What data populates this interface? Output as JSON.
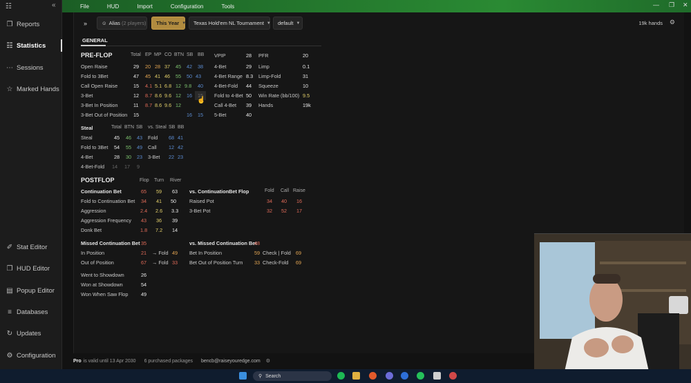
{
  "app": {
    "logo": "☷",
    "collapse": "«"
  },
  "menu": [
    "File",
    "HUD",
    "Import",
    "Configuration",
    "Tools"
  ],
  "sidebar": {
    "top": [
      {
        "icon": "❐",
        "label": "Reports"
      },
      {
        "icon": "☷",
        "label": "Statistics"
      },
      {
        "icon": "⋯",
        "label": "Sessions"
      },
      {
        "icon": "☆",
        "label": "Marked Hands"
      }
    ],
    "bottom": [
      {
        "icon": "✐",
        "label": "Stat Editor"
      },
      {
        "icon": "❐",
        "label": "HUD Editor"
      },
      {
        "icon": "▤",
        "label": "Popup Editor"
      },
      {
        "icon": "≡",
        "label": "Databases"
      },
      {
        "icon": "↻",
        "label": "Updates"
      },
      {
        "icon": "⚙",
        "label": "Configuration"
      }
    ]
  },
  "filters": {
    "expand": "»",
    "alias_label": "Alias",
    "alias_count": "(2 players)",
    "year": "This Year",
    "game": "Texas Hold'em NL Tournament",
    "preset": "default",
    "hands": "19k hands"
  },
  "tab": "GENERAL",
  "preflop": {
    "title": "PRE-FLOP",
    "cols": [
      "Total",
      "EP",
      "MP",
      "CO",
      "BTN",
      "SB",
      "BB"
    ],
    "rows": [
      {
        "label": "Open Raise",
        "vals": [
          "29",
          "20",
          "28",
          "37",
          "45",
          "42",
          "38"
        ]
      },
      {
        "label": "Fold to 3Bet",
        "vals": [
          "47",
          "45",
          "41",
          "46",
          "55",
          "50",
          "43"
        ]
      },
      {
        "label": "Call Open Raise",
        "vals": [
          "15",
          "4.1",
          "5.1",
          "6.8",
          "12",
          "9.8",
          "40"
        ]
      },
      {
        "label": "3-Bet",
        "vals": [
          "12",
          "8.7",
          "8.6",
          "9.6",
          "12",
          "16",
          "15"
        ]
      },
      {
        "label": "3-Bet In Position",
        "vals": [
          "11",
          "8.7",
          "8.6",
          "9.6",
          "12",
          "",
          ""
        ]
      },
      {
        "label": "3-Bet Out of Position",
        "vals": [
          "15",
          "",
          "",
          "",
          "",
          "16",
          "15"
        ]
      }
    ],
    "mid": [
      {
        "label": "VPIP",
        "val": "28"
      },
      {
        "label": "4-Bet",
        "val": "29"
      },
      {
        "label": "4-Bet Range",
        "val": "8.3"
      },
      {
        "label": "4-Bet-Fold",
        "val": "44"
      },
      {
        "label": "Fold to 4-Bet",
        "val": "50"
      },
      {
        "label": "Call 4-Bet",
        "val": "39"
      },
      {
        "label": "5-Bet",
        "val": "40"
      }
    ],
    "right": [
      {
        "label": "PFR",
        "val": "20"
      },
      {
        "label": "Limp",
        "val": "0.1"
      },
      {
        "label": "Limp-Fold",
        "val": "31"
      },
      {
        "label": "Squeeze",
        "val": "10"
      },
      {
        "label": "Win Rate (bb/100)",
        "val": "9.5"
      },
      {
        "label": "Hands",
        "val": "19k"
      }
    ]
  },
  "steal": {
    "cols": [
      "Steal",
      "Total",
      "BTN",
      "SB"
    ],
    "rows": [
      {
        "label": "Steal",
        "vals": [
          "45",
          "46",
          "43"
        ]
      },
      {
        "label": "Fold to 3Bet",
        "vals": [
          "54",
          "55",
          "49"
        ]
      },
      {
        "label": "4-Bet",
        "vals": [
          "28",
          "30",
          "23"
        ]
      },
      {
        "label": "4-Bet-Fold",
        "vals": [
          "14",
          "17",
          "9"
        ]
      }
    ],
    "vs_cols": [
      "vs. Steal",
      "SB",
      "BB"
    ],
    "vs_rows": [
      {
        "label": "Fold",
        "vals": [
          "68",
          "41"
        ]
      },
      {
        "label": "Call",
        "vals": [
          "12",
          "42"
        ]
      },
      {
        "label": "3-Bet",
        "vals": [
          "22",
          "23"
        ]
      }
    ]
  },
  "postflop": {
    "title": "POSTFLOP",
    "cols": [
      "Flop",
      "Turn",
      "River"
    ],
    "rows": [
      {
        "label": "Continuation Bet",
        "vals": [
          "65",
          "59",
          "63"
        ]
      },
      {
        "label": "Fold to Continuation Bet",
        "vals": [
          "34",
          "41",
          "50"
        ]
      },
      {
        "label": "Aggression",
        "vals": [
          "2.4",
          "2.6",
          "3.3"
        ]
      },
      {
        "label": "Aggression Frequency",
        "vals": [
          "43",
          "36",
          "39"
        ]
      },
      {
        "label": "Donk Bet",
        "vals": [
          "1.8",
          "7.2",
          "14"
        ]
      }
    ],
    "vs_title": "vs. ContinuationBet Flop",
    "vs_cols": [
      "Fold",
      "Call",
      "Raise"
    ],
    "vs_rows": [
      {
        "label": "Raised Pot",
        "vals": [
          "34",
          "40",
          "16"
        ]
      },
      {
        "label": "3-Bet Pot",
        "vals": [
          "32",
          "52",
          "17"
        ]
      }
    ],
    "missed": {
      "title": "Missed Continuation Bet",
      "title_val": "35",
      "rows": [
        {
          "label": "In Position",
          "val": "21",
          "sub": "→ Fold",
          "sub_val": "49"
        },
        {
          "label": "Out of Position",
          "val": "67",
          "sub": "→ Fold",
          "sub_val": "33"
        }
      ]
    },
    "vs_missed": {
      "title": "vs. Missed Continuation Bet",
      "title_val": "48",
      "rows": [
        {
          "label": "Bet In Position",
          "val": "59",
          "sub": "Check | Fold",
          "sub_val": "69"
        },
        {
          "label": "Bet Out of Position Turn",
          "val": "33",
          "sub": "Check-Fold",
          "sub_val": "69"
        }
      ]
    },
    "showdown": [
      {
        "label": "Went to Showdown",
        "val": "26"
      },
      {
        "label": "Won at Showdown",
        "val": "54"
      },
      {
        "label": "Won When Saw Flop",
        "val": "49"
      }
    ]
  },
  "status": {
    "pro": "Pro",
    "valid": "is valid until 13 Apr 2030",
    "packages": "6 purchased packages",
    "email": "bencb@raiseyouredge.com"
  },
  "taskbar": {
    "search": "Search"
  }
}
